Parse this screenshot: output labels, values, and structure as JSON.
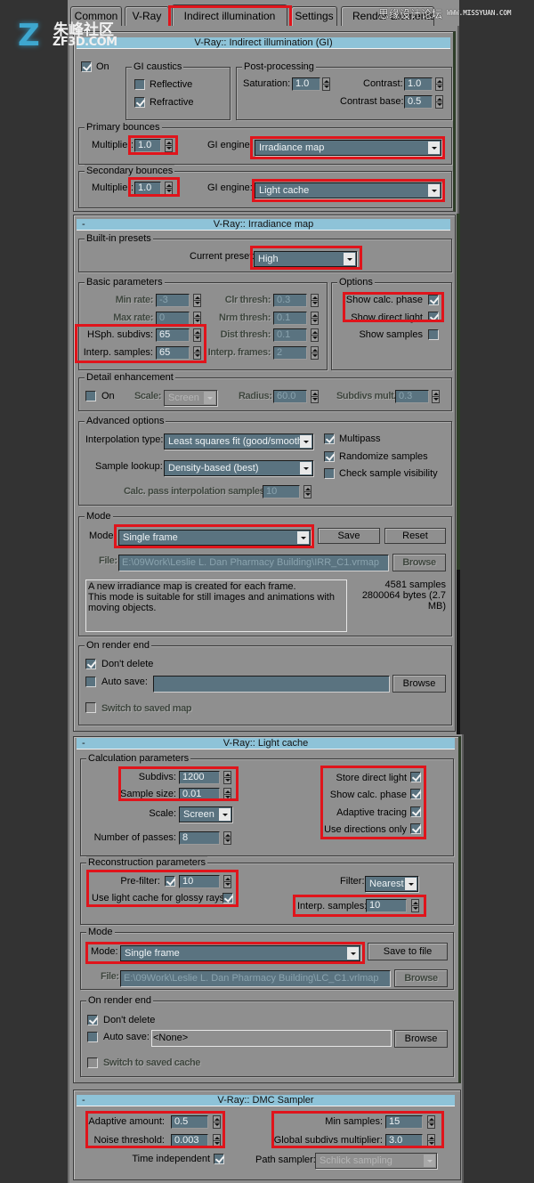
{
  "tabs": [
    {
      "label": "Common",
      "active": false
    },
    {
      "label": "V-Ray",
      "active": false
    },
    {
      "label": "Indirect illumination",
      "active": true
    },
    {
      "label": "Settings",
      "active": false
    },
    {
      "label": "Render Elements",
      "active": false
    }
  ],
  "watermarks": {
    "left_cn": "朱峰社区",
    "left_url": "ZF3D.COM",
    "right_cn": "思缘设计论坛",
    "right_url": "WWW.MISSYUAN.COM"
  },
  "colors": {
    "rollout_header": "#8ec3d8",
    "panel_bg": "#8f8f8f",
    "field_bg": "#5a7380",
    "highlight": "#e0141b",
    "page_bg": "#333333"
  },
  "gi": {
    "title": "V-Ray:: Indirect illumination (GI)",
    "on_label": "On",
    "on_checked": true,
    "caustics": {
      "title": "GI caustics",
      "reflective_label": "Reflective",
      "reflective_checked": false,
      "refractive_label": "Refractive",
      "refractive_checked": true
    },
    "post": {
      "title": "Post-processing",
      "saturation_label": "Saturation:",
      "saturation": "1.0",
      "contrast_label": "Contrast:",
      "contrast": "1.0",
      "contrast_base_label": "Contrast base:",
      "contrast_base": "0.5"
    },
    "primary": {
      "title": "Primary bounces",
      "multiplier_label": "Multiplier:",
      "multiplier": "1.0",
      "engine_label": "GI engine:",
      "engine": "Irradiance map"
    },
    "secondary": {
      "title": "Secondary bounces",
      "multiplier_label": "Multiplier:",
      "multiplier": "1.0",
      "engine_label": "GI engine:",
      "engine": "Light cache"
    }
  },
  "irr": {
    "title": "V-Ray:: Irradiance map",
    "minus": "-",
    "presets": {
      "title": "Built-in presets",
      "current_label": "Current preset:",
      "current": "High"
    },
    "basic": {
      "title": "Basic parameters",
      "min_rate_label": "Min rate:",
      "min_rate": "-3",
      "max_rate_label": "Max rate:",
      "max_rate": "0",
      "hsph_label": "HSph. subdivs:",
      "hsph": "65",
      "interp_label": "Interp. samples:",
      "interp": "65",
      "clr_label": "Clr thresh:",
      "clr": "0.3",
      "nrm_label": "Nrm thresh:",
      "nrm": "0.1",
      "dist_label": "Dist thresh:",
      "dist": "0.1",
      "frames_label": "Interp. frames:",
      "frames": "2"
    },
    "options": {
      "title": "Options",
      "show_calc_label": "Show calc. phase",
      "show_calc": true,
      "show_direct_label": "Show direct light",
      "show_direct": true,
      "show_samples_label": "Show samples",
      "show_samples": false
    },
    "detail": {
      "title": "Detail enhancement",
      "on_label": "On",
      "on": false,
      "scale_label": "Scale:",
      "scale": "Screen",
      "radius_label": "Radius:",
      "radius": "60.0",
      "subdivs_mult_label": "Subdivs mult.",
      "subdivs_mult": "0.3"
    },
    "advanced": {
      "title": "Advanced options",
      "interp_type_label": "Interpolation type:",
      "interp_type": "Least squares fit (good/smooth)",
      "lookup_label": "Sample lookup:",
      "lookup": "Density-based (best)",
      "calc_pass_label": "Calc. pass interpolation samples:",
      "calc_pass": "10",
      "multipass_label": "Multipass",
      "multipass": true,
      "randomize_label": "Randomize samples",
      "randomize": true,
      "check_vis_label": "Check sample visibility",
      "check_vis": false
    },
    "mode": {
      "title": "Mode",
      "mode_label": "Mode:",
      "mode": "Single frame",
      "save_label": "Save",
      "reset_label": "Reset",
      "file_label": "File:",
      "file": "E:\\09Work\\Leslie L. Dan Pharmacy Building\\IRR_C1.vrmap",
      "browse_label": "Browse",
      "description": [
        "A new irradiance map is created for each frame.",
        "This mode is suitable for still images and animations with",
        "moving objects."
      ],
      "samples": "4581 samples",
      "bytes_line1": "2800064 bytes (2.7",
      "bytes_line2": "MB)"
    },
    "render_end": {
      "title": "On render end",
      "dont_delete_label": "Don't delete",
      "dont_delete": true,
      "auto_save_label": "Auto save:",
      "auto_save": false,
      "auto_save_path": "",
      "browse_label": "Browse",
      "switch_label": "Switch to saved map",
      "switch": false
    }
  },
  "lc": {
    "title": "V-Ray:: Light cache",
    "minus": "-",
    "calc": {
      "title": "Calculation parameters",
      "subdivs_label": "Subdivs:",
      "subdivs": "1200",
      "sample_size_label": "Sample size:",
      "sample_size": "0.01",
      "scale_label": "Scale:",
      "scale": "Screen",
      "passes_label": "Number of passes:",
      "passes": "8",
      "store_direct_label": "Store direct light",
      "store_direct": true,
      "show_calc_label": "Show calc. phase",
      "show_calc": true,
      "adaptive_label": "Adaptive tracing",
      "adaptive": true,
      "directions_label": "Use directions only",
      "directions": true
    },
    "recon": {
      "title": "Reconstruction parameters",
      "prefilter_label": "Pre-filter:",
      "prefilter": true,
      "prefilter_value": "10",
      "glossy_label": "Use light cache for glossy rays",
      "glossy": true,
      "filter_label": "Filter:",
      "filter": "Nearest",
      "interp_label": "Interp. samples:",
      "interp": "10"
    },
    "mode": {
      "title": "Mode",
      "mode_label": "Mode:",
      "mode": "Single frame",
      "save_label": "Save to file",
      "file_label": "File:",
      "file": "E:\\09Work\\Leslie L. Dan Pharmacy Building\\LC_C1.vrlmap",
      "browse_label": "Browse"
    },
    "render_end": {
      "title": "On render end",
      "dont_delete_label": "Don't delete",
      "dont_delete": true,
      "auto_save_label": "Auto save:",
      "auto_save": false,
      "auto_save_path": "<None>",
      "browse_label": "Browse",
      "switch_label": "Switch to saved cache",
      "switch": false
    }
  },
  "dmc": {
    "title": "V-Ray:: DMC Sampler",
    "minus": "-",
    "adaptive_label": "Adaptive amount:",
    "adaptive": "0.5",
    "noise_label": "Noise threshold:",
    "noise": "0.003",
    "time_label": "Time independent",
    "time": true,
    "min_samples_label": "Min samples:",
    "min_samples": "15",
    "global_label": "Global subdivs multiplier:",
    "global": "3.0",
    "path_label": "Path sampler:",
    "path": "Schlick sampling"
  }
}
